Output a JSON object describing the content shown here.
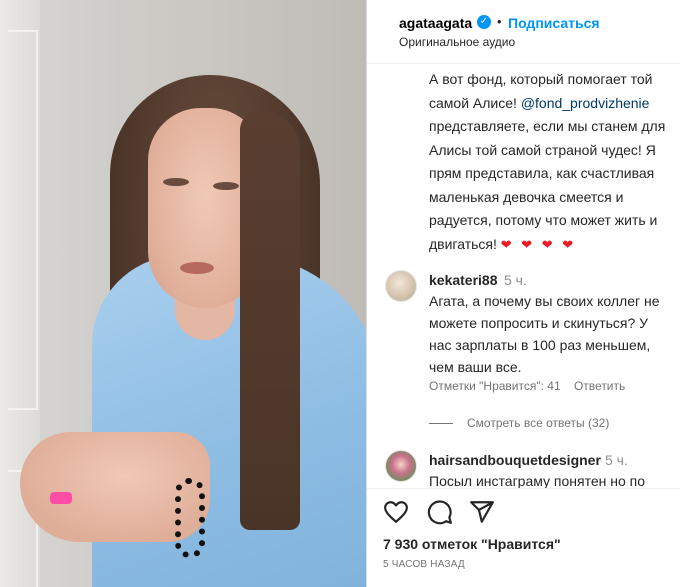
{
  "post": {
    "username": "agataagata",
    "verified": true,
    "separator": "•",
    "follow_label": "Подписаться",
    "audio_label": "Оригинальное аудио"
  },
  "caption": {
    "text_before_mention": "А вот фонд, который помогает той самой Алисе!",
    "mention": "@fond_prodvizhenie",
    "text_after_mention": "представляете, если мы станем для Алисы той самой страной чудес! Я прям представила, как счастливая маленькая девочка смеется и радуется, потому что может жить и двигаться!",
    "hearts": "❤ ❤ ❤ ❤"
  },
  "comments": [
    {
      "username": "kekateri88",
      "time": "5 ч.",
      "text": "Агата, а почему вы своих коллег не можете попросить и скинуться? У нас зарплаты в 100 раз меньшем, чем ваши все.",
      "likes_label": "Отметки \"Нравится\": 41",
      "reply_label": "Ответить",
      "view_replies": "Смотреть все ответы (32)"
    },
    {
      "username": "hairsandbouquetdesigner",
      "time": "5 ч.",
      "text": "Посыл инстаграму понятен но по"
    }
  ],
  "footer": {
    "likes": "7 930 отметок \"Нравится\"",
    "timeago": "5 часов назад"
  },
  "colors": {
    "accent": "#0095f6",
    "mention": "#00376b",
    "heart": "#ed1c24",
    "muted": "#8e8e8e"
  },
  "icons": [
    "verified-badge-icon",
    "heart-icon",
    "comment-icon",
    "share-icon",
    "like-comment-icon"
  ]
}
